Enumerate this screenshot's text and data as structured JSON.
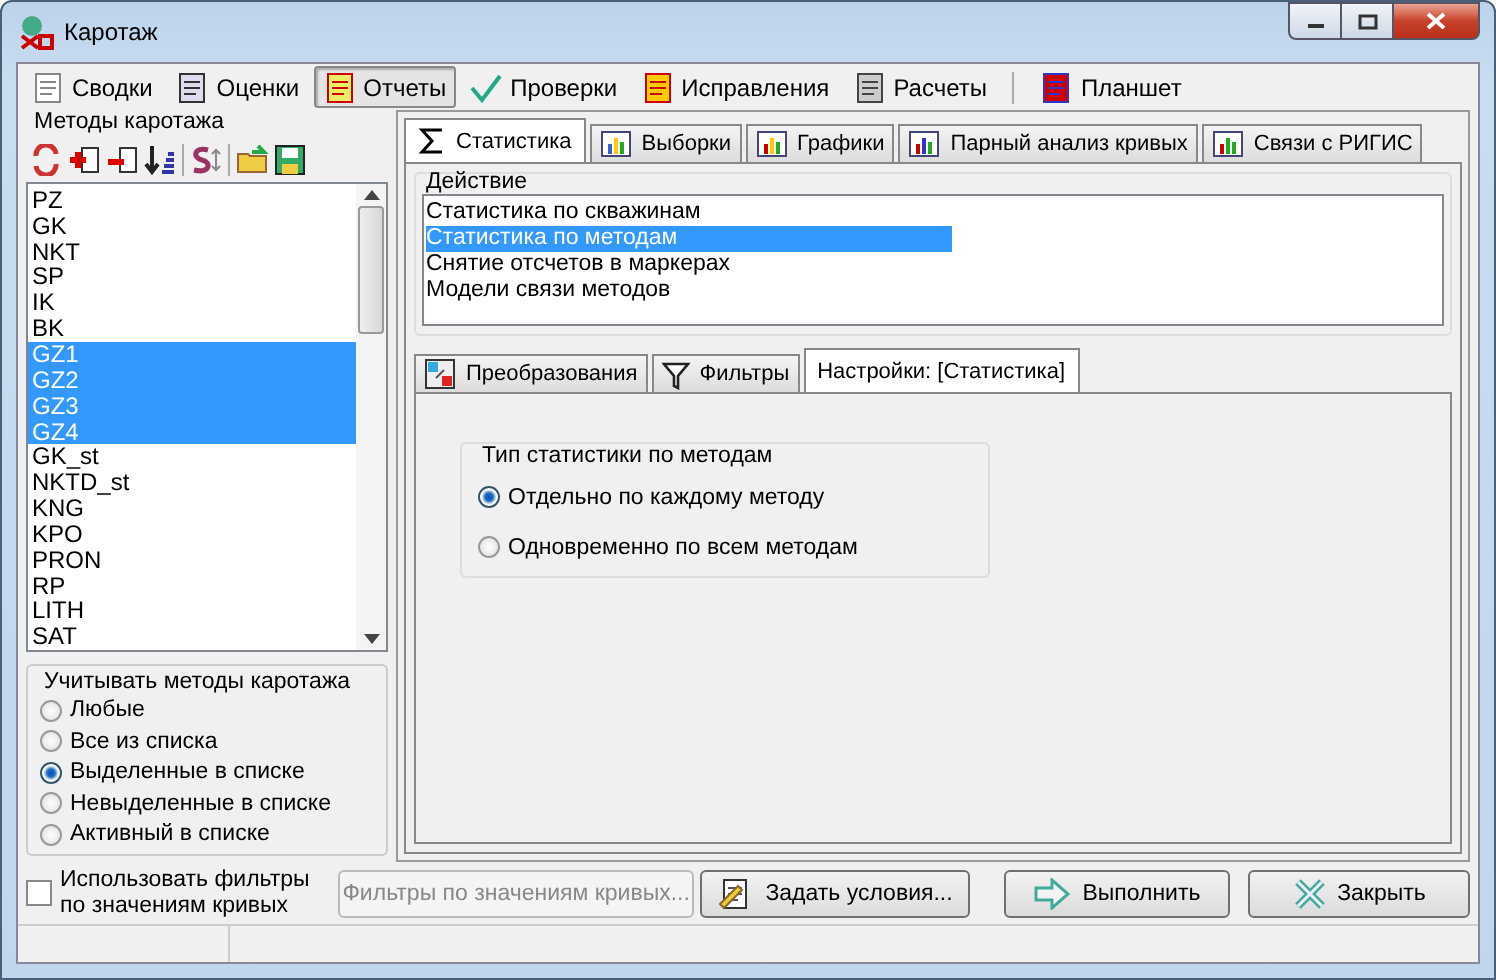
{
  "window": {
    "title": "Каротаж"
  },
  "toolbar": [
    {
      "label": "Сводки",
      "selected": false
    },
    {
      "label": "Оценки",
      "selected": false
    },
    {
      "label": "Отчеты",
      "selected": true
    },
    {
      "label": "Проверки",
      "selected": false
    },
    {
      "label": "Исправления",
      "selected": false
    },
    {
      "label": "Расчеты",
      "selected": false
    },
    {
      "label": "Планшет",
      "selected": false
    }
  ],
  "methods": {
    "title": "Методы каротажа",
    "items": [
      {
        "label": "PZ",
        "selected": false
      },
      {
        "label": "GK",
        "selected": false
      },
      {
        "label": "NKT",
        "selected": false
      },
      {
        "label": "SP",
        "selected": false
      },
      {
        "label": "IK",
        "selected": false
      },
      {
        "label": "BK",
        "selected": false
      },
      {
        "label": "GZ1",
        "selected": true
      },
      {
        "label": "GZ2",
        "selected": true
      },
      {
        "label": "GZ3",
        "selected": true
      },
      {
        "label": "GZ4",
        "selected": true
      },
      {
        "label": "GK_st",
        "selected": false
      },
      {
        "label": "NKTD_st",
        "selected": false
      },
      {
        "label": "KNG",
        "selected": false
      },
      {
        "label": "KPO",
        "selected": false
      },
      {
        "label": "PRON",
        "selected": false
      },
      {
        "label": "RP",
        "selected": false
      },
      {
        "label": "LITH",
        "selected": false
      },
      {
        "label": "SAT",
        "selected": false
      }
    ]
  },
  "methods_filter": {
    "title": "Учитывать методы каротажа",
    "options": [
      {
        "label": "Любые",
        "selected": false
      },
      {
        "label": "Все из списка",
        "selected": false
      },
      {
        "label": "Выделенные в списке",
        "selected": true
      },
      {
        "label": "Невыделенные в списке",
        "selected": false
      },
      {
        "label": "Активный в списке",
        "selected": false
      }
    ]
  },
  "main_tabs": [
    {
      "label": "Статистика",
      "selected": true
    },
    {
      "label": "Выборки",
      "selected": false
    },
    {
      "label": "Графики",
      "selected": false
    },
    {
      "label": "Парный анализ кривых",
      "selected": false
    },
    {
      "label": "Связи с РИГИС",
      "selected": false
    }
  ],
  "action": {
    "title": "Действие",
    "items": [
      {
        "label": "Статистика по скважинам",
        "selected": false
      },
      {
        "label": "Статистика по методам",
        "selected": true
      },
      {
        "label": "Снятие отсчетов в маркерах",
        "selected": false
      },
      {
        "label": "Модели связи методов",
        "selected": false
      }
    ]
  },
  "sub_tabs": [
    {
      "label": "Преобразования",
      "selected": false
    },
    {
      "label": "Фильтры",
      "selected": false
    },
    {
      "label": "Настройки: [Статистика]",
      "selected": true
    }
  ],
  "stat_type": {
    "title": "Тип статистики по методам",
    "options": [
      {
        "label": "Отдельно по каждому методу",
        "selected": true
      },
      {
        "label": "Одновременно по всем методам",
        "selected": false
      }
    ]
  },
  "curve_filter": {
    "label": "Использовать фильтры по значениям кривых",
    "checked": false
  },
  "buttons": [
    {
      "kind": "filter",
      "label": "Фильтры по значениям кривых...",
      "disabled": true
    },
    {
      "kind": "conditions",
      "label": "Задать условия...",
      "disabled": false
    },
    {
      "kind": "run",
      "label": "Выполнить",
      "disabled": false
    },
    {
      "kind": "close",
      "label": "Закрыть",
      "disabled": false
    }
  ]
}
